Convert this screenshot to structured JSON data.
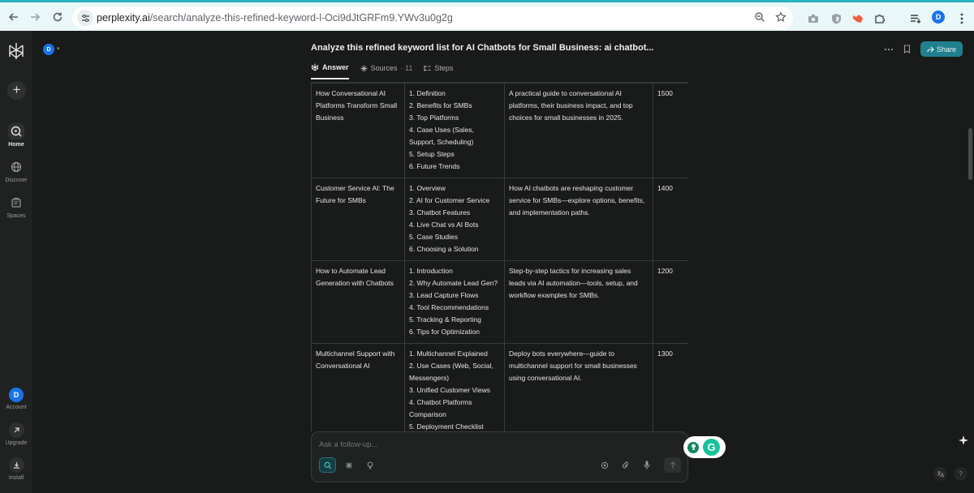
{
  "browser": {
    "url_host": "perplexity.ai",
    "url_path": "/search/analyze-this-refined-keyword-l-Oci9dJtGRFm9.YWv3u0g2g",
    "profile_initial": "D"
  },
  "sidebar": {
    "items": [
      {
        "label": "Home",
        "icon": "home-icon"
      },
      {
        "label": "Discover",
        "icon": "globe-icon"
      },
      {
        "label": "Spaces",
        "icon": "spaces-icon"
      }
    ],
    "account": {
      "initial": "D",
      "label": "Account"
    },
    "upgrade": {
      "label": "Upgrade"
    },
    "install": {
      "label": "Install"
    }
  },
  "header": {
    "space_initial": "D",
    "title": "Analyze this refined keyword list for AI Chatbots for Small Business: ai chatbot...",
    "share_label": "Share"
  },
  "tabs": [
    {
      "label": "Answer",
      "count": ""
    },
    {
      "label": "Sources",
      "count": "· 11"
    },
    {
      "label": "Steps",
      "count": ""
    }
  ],
  "table": {
    "rows": [
      {
        "title": "How Conversational AI Platforms Transform Small Business",
        "outline": [
          "1. Definition",
          "2. Benefits for SMBs",
          "3. Top Platforms",
          "4. Case Uses (Sales, Support, Scheduling)",
          "5. Setup Steps",
          "6. Future Trends"
        ],
        "description": "A practical guide to conversational AI platforms, their business impact, and top choices for small businesses in 2025.",
        "words": "1500"
      },
      {
        "title": "Customer Service AI: The Future for SMBs",
        "outline": [
          "1. Overview",
          "2. AI for Customer Service",
          "3. Chatbot Features",
          "4. Live Chat vs AI Bots",
          "5. Case Studies",
          "6. Choosing a Solution"
        ],
        "description": "How AI chatbots are reshaping customer service for SMBs—explore options, benefits, and implementation paths.",
        "words": "1400"
      },
      {
        "title": "How to Automate Lead Generation with Chatbots",
        "outline": [
          "1. Introduction",
          "2. Why Automate Lead Gen?",
          "3. Lead Capture Flows",
          "4. Tool Recommendations",
          "5. Tracking & Reporting",
          "6. Tips for Optimization"
        ],
        "description": "Step-by-step tactics for increasing sales leads via AI automation—tools, setup, and workflow examples for SMBs.",
        "words": "1200"
      },
      {
        "title": "Multichannel Support with Conversational AI",
        "outline": [
          "1. Multichannel Explained",
          "2. Use Cases (Web, Social, Messengers)",
          "3. Unified Customer Views",
          "4. Chatbot Platforms Comparison",
          "5. Deployment Checklist"
        ],
        "description": "Deploy bots everywhere—guide to multichannel support for small businesses using conversational AI.",
        "words": "1300"
      }
    ]
  },
  "composer": {
    "placeholder": "Ask a follow-up..."
  },
  "colors": {
    "accent": "#20808d",
    "background": "#191a1a",
    "sidebar": "#202222",
    "border": "#3a3c3c",
    "chrome": "#e9f7f8"
  }
}
